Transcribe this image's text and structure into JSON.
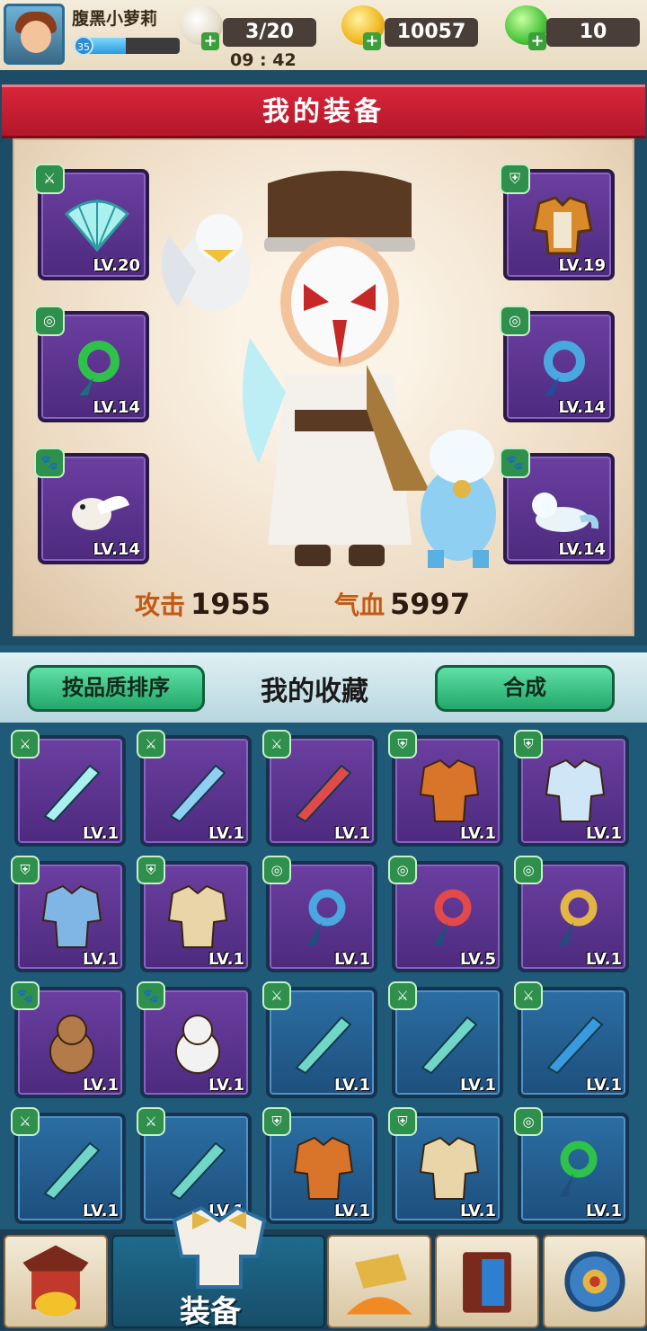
{
  "player": {
    "name": "腹黑小萝莉",
    "level": "35",
    "exp_fraction": 0.42
  },
  "resources": {
    "stamina": {
      "value": "3/20",
      "icon": "bun-icon"
    },
    "timer": "09 : 42",
    "gold": {
      "value": "10057",
      "icon": "gold-leaf-icon"
    },
    "jade": {
      "value": "10",
      "icon": "green-leaf-icon"
    }
  },
  "equip_panel": {
    "title": "我的装备",
    "slots": [
      {
        "name": "fan-weapon",
        "level": "LV.20",
        "tag": "weapon"
      },
      {
        "name": "armor",
        "level": "LV.19",
        "tag": "armor"
      },
      {
        "name": "jade-pendant",
        "level": "LV.14",
        "tag": "pendant"
      },
      {
        "name": "blue-pendant",
        "level": "LV.14",
        "tag": "pendant"
      },
      {
        "name": "white-bird-pet",
        "level": "LV.14",
        "tag": "pet"
      },
      {
        "name": "ferret-pet",
        "level": "LV.14",
        "tag": "pet"
      }
    ],
    "stats": {
      "attack_label": "攻击",
      "attack": "1955",
      "hp_label": "气血",
      "hp": "5997"
    }
  },
  "collection": {
    "sort_button": "按品质排序",
    "title": "我的收藏",
    "craft_button": "合成",
    "items": [
      {
        "item": "fan",
        "level": "LV.1",
        "tag": "weapon",
        "color": "purple"
      },
      {
        "item": "bow",
        "level": "LV.1",
        "tag": "weapon",
        "color": "purple"
      },
      {
        "item": "red-dagger",
        "level": "LV.1",
        "tag": "weapon",
        "color": "purple"
      },
      {
        "item": "orange-cloak",
        "level": "LV.1",
        "tag": "armor",
        "color": "purple"
      },
      {
        "item": "white-robe",
        "level": "LV.1",
        "tag": "armor",
        "color": "purple"
      },
      {
        "item": "blue-robe",
        "level": "LV.1",
        "tag": "armor",
        "color": "purple"
      },
      {
        "item": "tan-robe",
        "level": "LV.1",
        "tag": "armor",
        "color": "purple"
      },
      {
        "item": "blue-pendant",
        "level": "LV.1",
        "tag": "pendant",
        "color": "purple"
      },
      {
        "item": "red-pendant",
        "level": "LV.5",
        "tag": "pendant",
        "color": "purple"
      },
      {
        "item": "gold-pendant",
        "level": "LV.1",
        "tag": "pendant",
        "color": "purple"
      },
      {
        "item": "monkey-pet",
        "level": "LV.1",
        "tag": "pet",
        "color": "purple"
      },
      {
        "item": "panda-pet",
        "level": "LV.1",
        "tag": "pet",
        "color": "purple"
      },
      {
        "item": "teal-sword",
        "level": "LV.1",
        "tag": "weapon",
        "color": "blue"
      },
      {
        "item": "teal-sword-2",
        "level": "LV.1",
        "tag": "weapon",
        "color": "blue"
      },
      {
        "item": "blue-fan",
        "level": "LV.1",
        "tag": "weapon",
        "color": "blue"
      },
      {
        "item": "teal-dagger",
        "level": "LV.1",
        "tag": "weapon",
        "color": "blue"
      },
      {
        "item": "teal-dagger-2",
        "level": "LV.1",
        "tag": "weapon",
        "color": "blue"
      },
      {
        "item": "orange-cloak-2",
        "level": "LV.1",
        "tag": "armor",
        "color": "blue"
      },
      {
        "item": "tan-robe-2",
        "level": "LV.1",
        "tag": "armor",
        "color": "blue"
      },
      {
        "item": "jade-pendant",
        "level": "LV.1",
        "tag": "pendant",
        "color": "blue"
      }
    ]
  },
  "nav": {
    "active_label": "装备"
  }
}
